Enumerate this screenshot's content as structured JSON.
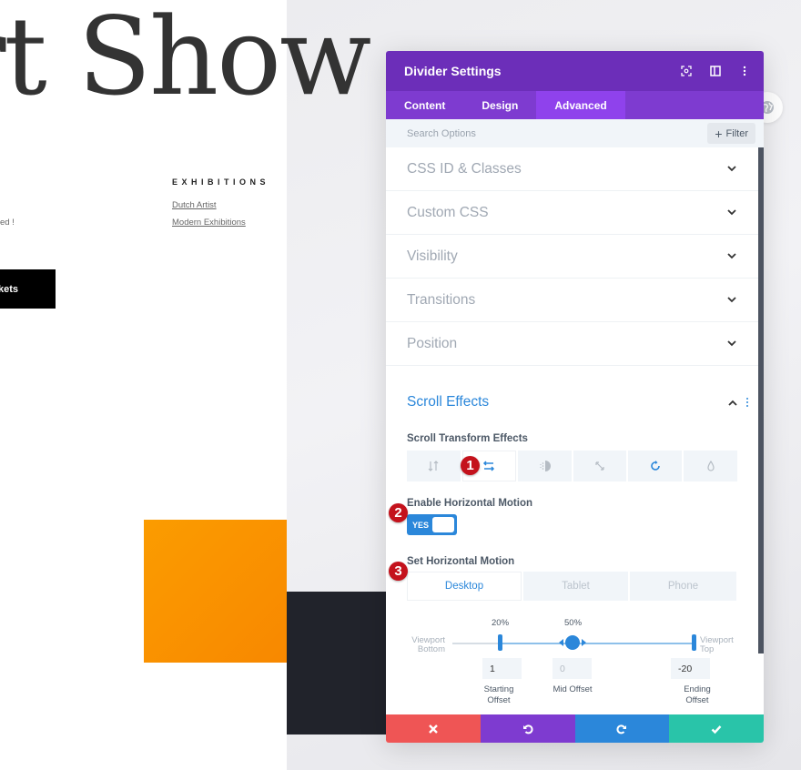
{
  "page": {
    "hero_title": "rt Show",
    "exhibitions_heading": "EXHIBITIONS",
    "exhibition_links": [
      "Dutch Artist",
      "Modern Exhibitions"
    ],
    "partial_text": "ed !",
    "tickets_button": "kets"
  },
  "modal": {
    "title": "Divider Settings",
    "header_icons": [
      "focus-icon",
      "split-view-icon",
      "more-options-icon"
    ],
    "tabs": [
      {
        "label": "Content",
        "active": false
      },
      {
        "label": "Design",
        "active": false
      },
      {
        "label": "Advanced",
        "active": true
      }
    ],
    "search_placeholder": "Search Options",
    "filter_label": "Filter",
    "sections": [
      {
        "label": "CSS ID & Classes",
        "expanded": false
      },
      {
        "label": "Custom CSS",
        "expanded": false
      },
      {
        "label": "Visibility",
        "expanded": false
      },
      {
        "label": "Transitions",
        "expanded": false
      },
      {
        "label": "Position",
        "expanded": false
      }
    ],
    "scroll_effects": {
      "title": "Scroll Effects",
      "transform_label": "Scroll Transform Effects",
      "effects": [
        {
          "name": "vertical-motion",
          "active": false
        },
        {
          "name": "horizontal-motion",
          "active": true
        },
        {
          "name": "fading",
          "active": false
        },
        {
          "name": "scaling",
          "active": false
        },
        {
          "name": "rotating",
          "active": false
        },
        {
          "name": "blur",
          "active": false
        }
      ],
      "enable_label": "Enable Horizontal Motion",
      "toggle_value": "YES",
      "set_label": "Set Horizontal Motion",
      "devices": [
        {
          "label": "Desktop",
          "active": true
        },
        {
          "label": "Tablet",
          "active": false
        },
        {
          "label": "Phone",
          "active": false
        }
      ],
      "motion": {
        "viewport_bottom": "Viewport Bottom",
        "viewport_top": "Viewport Top",
        "start_percent": "20%",
        "mid_percent": "50%",
        "start_position": 0.2,
        "mid_position": 0.5,
        "end_position": 1.0,
        "starting_offset": "1",
        "mid_offset": "0",
        "ending_offset": "-20",
        "starting_label": "Starting Offset",
        "mid_label": "Mid Offset",
        "ending_label": "Ending Offset"
      }
    },
    "badges": [
      "1",
      "2",
      "3"
    ],
    "footer": [
      "cancel",
      "undo",
      "redo",
      "save"
    ]
  },
  "colors": {
    "header_purple": "#6c2eb9",
    "tabs_purple": "#7e3bd0",
    "accent_blue": "#2b87da",
    "cancel_red": "#ef5555",
    "save_green": "#29c4a9",
    "badge_red": "#c4121c",
    "orange": "#fb9c00"
  }
}
